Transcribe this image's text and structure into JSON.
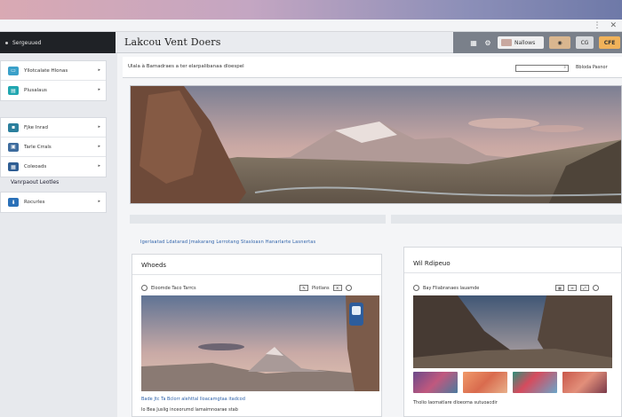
{
  "app": {
    "title": "Lakcou Vent Doers",
    "sidebar_header": "Sergeuued"
  },
  "header": {
    "pill_label": "Nallows",
    "pill_tan": "",
    "pill_gray": "CG",
    "pill_orange": "CFE"
  },
  "sidebar": {
    "group1": [
      {
        "label": "Yllotcalate Hlonas",
        "color": "#3aa0c9"
      },
      {
        "label": "Plusalaus",
        "color": "#20a6b0"
      }
    ],
    "group2": [
      {
        "label": "Fjke Inrad",
        "color": "#2b7f9d"
      },
      {
        "label": "Tarle Crrals",
        "color": "#3e6c9e"
      },
      {
        "label": "Coleoads",
        "color": "#2e5d93"
      }
    ],
    "section_label": "Vanrpaout Leotles",
    "group3": [
      {
        "label": "Rocurles",
        "color": "#2a70b8"
      }
    ]
  },
  "subbar": {
    "breadcrumb": "Ulala à Bamadraes a ter elarpalibanaa dloespel",
    "search_placeholder": "",
    "sort_label": "Bbloda Pasnor"
  },
  "links": "Igerlaatad Ldatarad Jmakarang Lerrotang Stasloasn Hanarlarte Lasnertas",
  "card_left": {
    "title": "Whoeds",
    "toolbar_label": "Eloomde Taco Tarrcs",
    "toolbar_right": "Plotlans",
    "caption1": "Bade  Jtc  Ta  Bclorr alehttal  lloacamgtaa  itadcod",
    "caption2": "Io  Bea Juslig inceorumd lamaimnoarae stab"
  },
  "card_right": {
    "title": "Wil Rdipeuo",
    "toolbar_label": "Bay Fliabranaes lauamde",
    "caption": "Tholio laomatlare dloeoma sutuoacdir"
  },
  "colors": {
    "accent": "#2a5fa8",
    "sidebar_dark": "#1f2226",
    "header_gray": "#7a808a",
    "orange": "#f0b25a"
  }
}
